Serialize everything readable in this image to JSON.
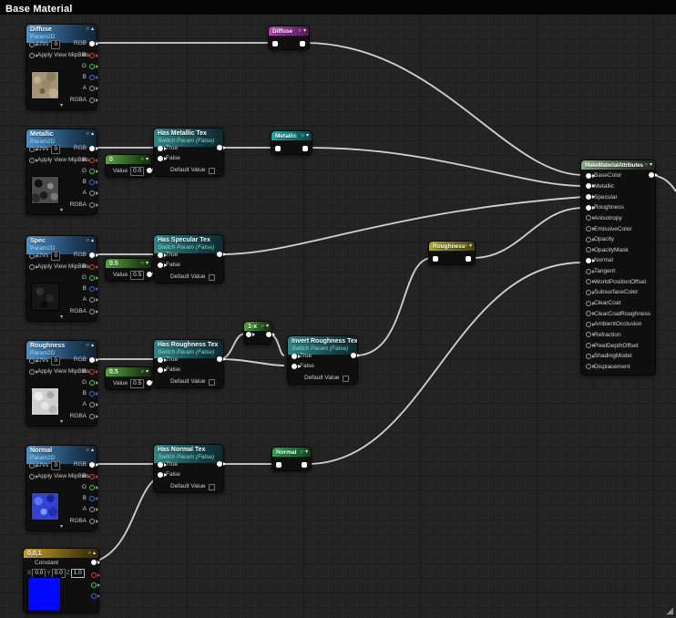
{
  "window": {
    "title": "Base Material"
  },
  "icons": {
    "dot": "○",
    "chevron_up": "▴",
    "chevron_down": "▾",
    "resize_grip": "◢"
  },
  "labels": {
    "uvs": "UVs",
    "mipbias": "Apply View MipBias",
    "rgb": "RGB",
    "r": "R",
    "g": "G",
    "b": "B",
    "a": "A",
    "rgba": "RGBA",
    "true": "True",
    "false": "False",
    "default_value": "Default Value",
    "value": "Value",
    "constant": "Constant",
    "x": "X",
    "y": "Y",
    "z": "Z"
  },
  "nodes": {
    "diffuse": {
      "title": "Diffuse",
      "subtitle": "Param2D",
      "uvs_value": "0"
    },
    "metallic": {
      "title": "Metallic",
      "subtitle": "Param2D",
      "uvs_value": "0"
    },
    "spec": {
      "title": "Spec",
      "subtitle": "Param2D",
      "uvs_value": "0"
    },
    "roughness": {
      "title": "Roughness",
      "subtitle": "Param2D",
      "uvs_value": "0"
    },
    "normal": {
      "title": "Normal",
      "subtitle": "Param2D",
      "uvs_value": "0"
    },
    "scalar_metallic": {
      "title": "0",
      "value": "0.0"
    },
    "scalar_spec": {
      "title": "0.5",
      "value": "0.5"
    },
    "scalar_roughness": {
      "title": "0.5",
      "value": "0.5"
    },
    "switch_metallic": {
      "title": "Has Metallic Tex",
      "subtitle": "Switch Param (False)"
    },
    "switch_specular": {
      "title": "Has Specular Tex",
      "subtitle": "Switch Param (False)"
    },
    "switch_roughness": {
      "title": "Has Roughness Tex",
      "subtitle": "Switch Param (False)"
    },
    "switch_invert_roughness": {
      "title": "Invert Roughness Tex",
      "subtitle": "Switch Param (False)"
    },
    "switch_normal": {
      "title": "Has Normal Tex",
      "subtitle": "Switch Param (False)"
    },
    "one_minus": {
      "title": "1-x"
    },
    "reroute_diffuse": {
      "title": "Diffuse"
    },
    "reroute_metallic": {
      "title": "Metallic"
    },
    "reroute_roughness": {
      "title": "Roughness"
    },
    "reroute_normal": {
      "title": "Normal"
    },
    "const_001": {
      "title": "0,0,1",
      "x": "0.0",
      "y": "0.0",
      "z": "1.0"
    },
    "mma": {
      "title": "MakeMaterialAttributes",
      "pins": [
        {
          "label": "BaseColor",
          "connected": true
        },
        {
          "label": "Metallic",
          "connected": true
        },
        {
          "label": "Specular",
          "connected": true
        },
        {
          "label": "Roughness",
          "connected": true
        },
        {
          "label": "Anisotropy",
          "connected": false
        },
        {
          "label": "EmissiveColor",
          "connected": false
        },
        {
          "label": "Opacity",
          "connected": false
        },
        {
          "label": "OpacityMask",
          "connected": false
        },
        {
          "label": "Normal",
          "connected": true
        },
        {
          "label": "Tangent",
          "connected": false
        },
        {
          "label": "WorldPositionOffset",
          "connected": false
        },
        {
          "label": "SubsurfaceColor",
          "connected": false
        },
        {
          "label": "ClearCoat",
          "connected": false
        },
        {
          "label": "ClearCoatRoughness",
          "connected": false
        },
        {
          "label": "AmbientOcclusion",
          "connected": false
        },
        {
          "label": "Refraction",
          "connected": false
        },
        {
          "label": "PixelDepthOffset",
          "connected": false
        },
        {
          "label": "ShadingModel",
          "connected": false
        },
        {
          "label": "Displacement",
          "connected": false
        }
      ]
    }
  },
  "colors": {
    "wire": "#dcdcdc",
    "header_texture_param": "#4a8fc8",
    "header_switch_param": "#2f8585",
    "header_scalar_param": "#55a63c",
    "header_make_attributes": "#8aa88a",
    "header_constant3": "#c9a227",
    "reroute_diffuse": "#c43fc4",
    "reroute_metallic": "#19adae",
    "reroute_roughness": "#aeae1e",
    "reroute_normal": "#23ae4f",
    "pin_red": "#e0392f",
    "pin_green": "#3fd13f",
    "pin_blue": "#3b6fe0"
  }
}
